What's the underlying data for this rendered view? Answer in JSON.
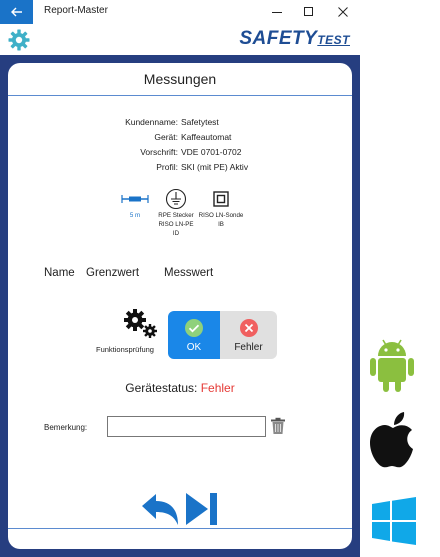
{
  "window": {
    "title": "Report-Master",
    "back_icon": "arrow-left-icon",
    "minimize_glyph": "—",
    "maximize_glyph": "☐",
    "close_glyph": "✕"
  },
  "appbar": {
    "brand_main": "SAFETY",
    "brand_sub": "TEST",
    "settings_icon": "gear-icon"
  },
  "page": {
    "title": "Messungen"
  },
  "info": [
    {
      "key": "Kundenname:",
      "value": "Safetytest"
    },
    {
      "key": "Gerät:",
      "value": "Kaffeautomat"
    },
    {
      "key": "Vorschrift:",
      "value": "VDE 0701-0702"
    },
    {
      "key": "Profil:",
      "value": "SKI (mit PE) Aktiv"
    }
  ],
  "tests": [
    {
      "icon": "cable-length-icon",
      "lines": [
        "5 m"
      ],
      "color": "#1a73c8"
    },
    {
      "icon": "protective-earth-icon",
      "lines": [
        "RPE Stecker",
        "RISO LN-PE",
        "ID"
      ],
      "color": "#222222"
    },
    {
      "icon": "double-insulation-icon",
      "lines": [
        "RISO LN-Sonde",
        "IB"
      ],
      "color": "#222222"
    }
  ],
  "columns": {
    "name": "Name",
    "limit": "Grenzwert",
    "measured": "Messwert"
  },
  "function_test": {
    "label": "Funktionsprüfung",
    "icon": "gears-icon",
    "ok_label": "OK",
    "fail_label": "Fehler",
    "ok_color": "#1a87e8",
    "fail_color": "#e53935"
  },
  "status": {
    "label": "Gerätestatus:",
    "value": "Fehler",
    "value_color": "#e53935"
  },
  "remark": {
    "label": "Bemerkung:",
    "value": "",
    "delete_icon": "trash-icon"
  },
  "nav": {
    "back_icon": "undo-arrow-icon",
    "next_icon": "skip-next-icon",
    "color": "#1a73c8"
  },
  "os_logos": [
    "android-logo",
    "apple-logo",
    "windows-logo"
  ]
}
